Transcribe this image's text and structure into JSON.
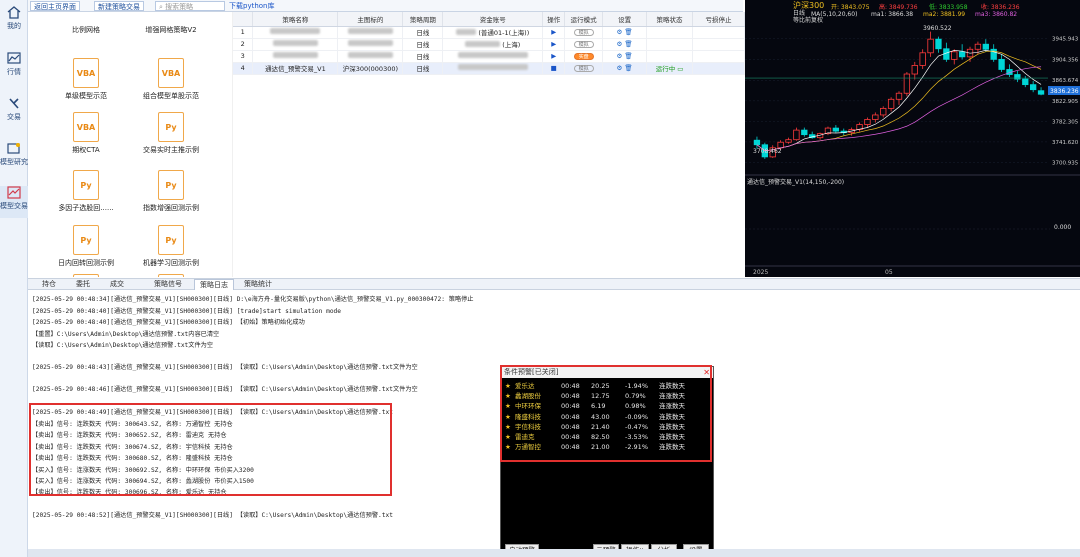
{
  "nav": [
    {
      "label": "我的",
      "icon": "home-icon"
    },
    {
      "label": "行情",
      "icon": "chart-icon"
    },
    {
      "label": "交易",
      "icon": "trade-icon"
    },
    {
      "label": "模型研究",
      "icon": "research-icon"
    },
    {
      "label": "模型交易",
      "icon": "model-trade-icon"
    }
  ],
  "topbar": {
    "home": "返回主页界面",
    "new": "新建策略交易",
    "search_placeholder": "搜索策略",
    "download": "下载python库"
  },
  "strategies": [
    {
      "label": "比例网格",
      "type": ""
    },
    {
      "label": "增强网格策略V2",
      "type": ""
    },
    {
      "label": "单级模型示范",
      "type": "VBA"
    },
    {
      "label": "组合模型单股示范",
      "type": "VBA"
    },
    {
      "label": "期权CTA",
      "type": "VBA"
    },
    {
      "label": "交易实时主推示例",
      "type": "Py"
    },
    {
      "label": "多因子选股回......",
      "type": "Py"
    },
    {
      "label": "指数增强回测示例",
      "type": "Py"
    },
    {
      "label": "日内回转回测示例",
      "type": "Py"
    },
    {
      "label": "机器学习回测示例",
      "type": "Py"
    },
    {
      "label": "",
      "type": "Py"
    },
    {
      "label": "",
      "type": "Py"
    }
  ],
  "table": {
    "headers": [
      "",
      "策略名称",
      "主图标的",
      "策略周期",
      "资金账号",
      "操作",
      "运行模式",
      "设置",
      "策略状态",
      "亏损停止"
    ],
    "rows": [
      {
        "no": "1",
        "name": "",
        "target": "",
        "period": "日线",
        "account": "(普通01-1(上海))",
        "op": "▶",
        "mode": "模拟",
        "status": ""
      },
      {
        "no": "2",
        "name": "",
        "target": "",
        "period": "日线",
        "account": "(上海)",
        "op": "▶",
        "mode": "模拟",
        "status": ""
      },
      {
        "no": "3",
        "name": "",
        "target": "",
        "period": "日线",
        "account": "",
        "op": "▶",
        "mode": "实盘",
        "status": ""
      },
      {
        "no": "4",
        "name": "通达信_预警交易_V1",
        "target": "沪深300(000300)",
        "period": "日线",
        "account": "",
        "op": "■",
        "mode": "模拟",
        "status": "运行中"
      }
    ]
  },
  "chart": {
    "symbol": "沪深300",
    "period": "日线",
    "adj": "等比前复权",
    "ohlc": {
      "open": "开: 3843.075",
      "high": "高: 3849.736",
      "low": "低: 3833.958",
      "close": "收: 3836.236"
    },
    "ma": "MA(5,10,20,60)",
    "ma1": "ma1: 3866.38",
    "ma2": "ma2: 3881.99",
    "ma3": "ma3: 3860.82",
    "hi_label": "3960.522",
    "lo_label": "3708.462",
    "y_ticks": [
      "3945.943",
      "3904.356",
      "3863.674",
      "3822.905",
      "3782.305",
      "3741.620",
      "3700.935"
    ],
    "last_price": "3836.236",
    "sub_title": "通达信_预警交易_V1(14,150,-200)",
    "sub_zero": "0.000",
    "x_labels": [
      "2025",
      "05"
    ],
    "candles": [
      {
        "o": 3745,
        "h": 3752,
        "l": 3728,
        "c": 3736
      },
      {
        "o": 3736,
        "h": 3740,
        "l": 3708,
        "c": 3712
      },
      {
        "o": 3712,
        "h": 3735,
        "l": 3710,
        "c": 3730
      },
      {
        "o": 3730,
        "h": 3745,
        "l": 3726,
        "c": 3741
      },
      {
        "o": 3741,
        "h": 3750,
        "l": 3738,
        "c": 3746
      },
      {
        "o": 3746,
        "h": 3770,
        "l": 3744,
        "c": 3765
      },
      {
        "o": 3765,
        "h": 3770,
        "l": 3752,
        "c": 3756
      },
      {
        "o": 3756,
        "h": 3762,
        "l": 3748,
        "c": 3750
      },
      {
        "o": 3750,
        "h": 3760,
        "l": 3746,
        "c": 3758
      },
      {
        "o": 3758,
        "h": 3772,
        "l": 3755,
        "c": 3769
      },
      {
        "o": 3769,
        "h": 3775,
        "l": 3760,
        "c": 3763
      },
      {
        "o": 3763,
        "h": 3768,
        "l": 3755,
        "c": 3760
      },
      {
        "o": 3760,
        "h": 3770,
        "l": 3754,
        "c": 3766
      },
      {
        "o": 3766,
        "h": 3780,
        "l": 3762,
        "c": 3776
      },
      {
        "o": 3776,
        "h": 3790,
        "l": 3770,
        "c": 3786
      },
      {
        "o": 3786,
        "h": 3800,
        "l": 3780,
        "c": 3795
      },
      {
        "o": 3795,
        "h": 3812,
        "l": 3790,
        "c": 3808
      },
      {
        "o": 3808,
        "h": 3830,
        "l": 3802,
        "c": 3826
      },
      {
        "o": 3826,
        "h": 3842,
        "l": 3815,
        "c": 3838
      },
      {
        "o": 3838,
        "h": 3880,
        "l": 3832,
        "c": 3876
      },
      {
        "o": 3876,
        "h": 3900,
        "l": 3865,
        "c": 3893
      },
      {
        "o": 3893,
        "h": 3925,
        "l": 3886,
        "c": 3918
      },
      {
        "o": 3918,
        "h": 3960,
        "l": 3910,
        "c": 3945
      },
      {
        "o": 3945,
        "h": 3950,
        "l": 3918,
        "c": 3926
      },
      {
        "o": 3926,
        "h": 3938,
        "l": 3900,
        "c": 3905
      },
      {
        "o": 3905,
        "h": 3925,
        "l": 3895,
        "c": 3920
      },
      {
        "o": 3920,
        "h": 3935,
        "l": 3905,
        "c": 3910
      },
      {
        "o": 3910,
        "h": 3930,
        "l": 3900,
        "c": 3925
      },
      {
        "o": 3925,
        "h": 3940,
        "l": 3915,
        "c": 3935
      },
      {
        "o": 3935,
        "h": 3945,
        "l": 3920,
        "c": 3925
      },
      {
        "o": 3925,
        "h": 3935,
        "l": 3900,
        "c": 3905
      },
      {
        "o": 3905,
        "h": 3915,
        "l": 3880,
        "c": 3885
      },
      {
        "o": 3885,
        "h": 3895,
        "l": 3870,
        "c": 3875
      },
      {
        "o": 3875,
        "h": 3882,
        "l": 3860,
        "c": 3866
      },
      {
        "o": 3866,
        "h": 3872,
        "l": 3850,
        "c": 3855
      },
      {
        "o": 3855,
        "h": 3862,
        "l": 3840,
        "c": 3845
      },
      {
        "o": 3843,
        "h": 3849.7,
        "l": 3834,
        "c": 3836
      }
    ]
  },
  "tabs": [
    "持仓",
    "委托",
    "成交",
    "策略信号",
    "策略日志",
    "策略统计"
  ],
  "active_tab": "策略日志",
  "log": [
    "[2025-05-29 00:48:34][通达信_预警交易_V1][SH000300][日线] D:\\e海方舟-量化交易版\\python\\通达信_预警交易_V1.py_000300472: 策略停止",
    "[2025-05-29 00:48:40][通达信_预警交易_V1][SH000300][日线] [trade]start simulation mode",
    "[2025-05-29 00:48:40][通达信_预警交易_V1][SH000300][日线] 【初始】策略初始化成功",
    "【重置】C:\\Users\\Admin\\Desktop\\通达信预警.txt内容已清空",
    "【读取】C:\\Users\\Admin\\Desktop\\通达信预警.txt文件为空",
    "",
    "[2025-05-29 00:48:43][通达信_预警交易_V1][SH000300][日线] 【读取】C:\\Users\\Admin\\Desktop\\通达信预警.txt文件为空",
    "",
    "[2025-05-29 00:48:46][通达信_预警交易_V1][SH000300][日线] 【读取】C:\\Users\\Admin\\Desktop\\通达信预警.txt文件为空",
    "",
    "[2025-05-29 00:48:49][通达信_预警交易_V1][SH000300][日线] 【读取】C:\\Users\\Admin\\Desktop\\通达信预警.txt",
    "【卖出】信号: 连跌数天 代码: 300643.SZ, 名称: 万通智控 无持仓",
    "【卖出】信号: 连跌数天 代码: 300652.SZ, 名称: 雷迪克 无持仓",
    "【卖出】信号: 连跌数天 代码: 300674.SZ, 名称: 宇信科技 无持仓",
    "【卖出】信号: 连跌数天 代码: 300680.SZ, 名称: 隆盛科技 无持仓",
    "【买入】信号: 连涨数天 代码: 300692.SZ, 名称: 中环环保 市价买入3200",
    "【买入】信号: 连涨数天 代码: 300694.SZ, 名称: 蠡湖股份 市价买入1500",
    "【卖出】信号: 连跌数天 代码: 300696.SZ, 名称: 爱乐达 无持仓",
    "",
    "[2025-05-29 00:48:52][通达信_预警交易_V1][SH000300][日线] 【读取】C:\\Users\\Admin\\Desktop\\通达信预警.txt"
  ],
  "popup": {
    "title": "条件预警[已关闭]",
    "rows": [
      {
        "name": "爱乐达",
        "time": "00:48",
        "price": "20.25",
        "pct": "-1.94%",
        "cond": "连跌数天"
      },
      {
        "name": "蠡湖股份",
        "time": "00:48",
        "price": "12.75",
        "pct": "0.79%",
        "cond": "连涨数天"
      },
      {
        "name": "中环环保",
        "time": "00:48",
        "price": "6.19",
        "pct": "0.98%",
        "cond": "连涨数天"
      },
      {
        "name": "隆盛科技",
        "time": "00:48",
        "price": "43.00",
        "pct": "-0.09%",
        "cond": "连跌数天"
      },
      {
        "name": "宇信科技",
        "time": "00:48",
        "price": "21.40",
        "pct": "-0.47%",
        "cond": "连跌数天"
      },
      {
        "name": "雷迪克",
        "time": "00:48",
        "price": "82.50",
        "pct": "-3.53%",
        "cond": "连跌数天"
      },
      {
        "name": "万通智控",
        "time": "00:48",
        "price": "21.00",
        "pct": "-2.91%",
        "cond": "连跌数天"
      }
    ],
    "buttons": {
      "start": "启动预警",
      "cloud": "云预警",
      "action": "操作∨",
      "analyze": "分析",
      "settings": "设置"
    }
  },
  "colors": {
    "up": "#ff3b3b",
    "down": "#00d6d6",
    "accent": "#1d4f9c"
  }
}
